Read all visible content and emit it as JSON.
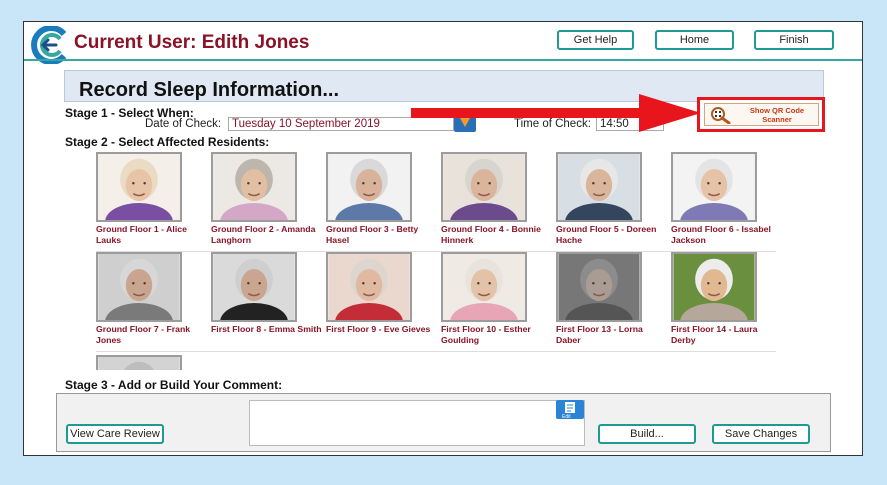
{
  "header": {
    "title": "Current User: Edith Jones",
    "buttons": {
      "help": "Get Help",
      "home": "Home",
      "finish": "Finish"
    }
  },
  "section": {
    "title": "Record Sleep Information..."
  },
  "stage1": {
    "label": "Stage 1 - Select When:",
    "date_label": "Date of Check:",
    "date_value": "Tuesday 10 September 2019",
    "time_label": "Time of Check:",
    "time_value": "14:50",
    "qr_button": "Show QR Code Scanner"
  },
  "stage2": {
    "label": "Stage 2 - Select Affected Residents:",
    "residents": [
      {
        "name": "Ground Floor 1 - Alice Lauks",
        "shirt": "#7a4fa3",
        "hair": "#e9dcc2",
        "skin": "#e8c3a5",
        "bg": "#f4efe9"
      },
      {
        "name": "Ground Floor 2 - Amanda Langhorn",
        "shirt": "#d4a7c7",
        "hair": "#bcb6ad",
        "skin": "#e2bfa2",
        "bg": "#ece9e4"
      },
      {
        "name": "Ground Floor 3 - Betty Hasel",
        "shirt": "#5d79a8",
        "hair": "#d9d9d9",
        "skin": "#d8b29a",
        "bg": "#f2f2f2"
      },
      {
        "name": "Ground Floor 4 - Bonnie Hinnerk",
        "shirt": "#6b4b8b",
        "hair": "#d8d4cf",
        "skin": "#dab49b",
        "bg": "#e9e2da"
      },
      {
        "name": "Ground Floor 5 - Doreen Hache",
        "shirt": "#34465e",
        "hair": "#e7e7e7",
        "skin": "#d9b59b",
        "bg": "#d7dfe5"
      },
      {
        "name": "Ground Floor 6 - Issabel Jackson",
        "shirt": "#7f79b6",
        "hair": "#e4e4e4",
        "skin": "#e6c2a7",
        "bg": "#f3f3f3"
      },
      {
        "name": "Ground Floor 7 - Frank Jones",
        "shirt": "#7a7a7a",
        "hair": "#d7d7d7",
        "skin": "#c9a48f",
        "bg": "#cfcfcf"
      },
      {
        "name": "First Floor 8 - Emma Smith",
        "shirt": "#222222",
        "hair": "#cfcfcf",
        "skin": "#caa58f",
        "bg": "#dadada"
      },
      {
        "name": "First Floor 9 - Eve Gieves",
        "shirt": "#c42d37",
        "hair": "#dcd6cf",
        "skin": "#e0b9a0",
        "bg": "#ead8cf"
      },
      {
        "name": "First Floor 10 - Esther Goulding",
        "shirt": "#e8a5b6",
        "hair": "#e8e4dd",
        "skin": "#e3c2a8",
        "bg": "#efeae4"
      },
      {
        "name": "First Floor 13 - Lorna Daber",
        "shirt": "#555555",
        "hair": "#8c8c8c",
        "skin": "#a99c92",
        "bg": "#777777"
      },
      {
        "name": "First Floor 14 - Laura Derby",
        "shirt": "#b6a79b",
        "hair": "#ececec",
        "skin": "#e1b990",
        "bg": "#6a8f3e"
      },
      {
        "name": "",
        "shirt": "#8a8a8a",
        "hair": "#bdbdbd",
        "skin": "#c9a48f",
        "bg": "#d3d3d3"
      }
    ]
  },
  "stage3": {
    "label": "Stage 3 - Add or Build Your Comment:",
    "view_care_review": "View Care Review",
    "edit_icon_label": "Edit",
    "build": "Build...",
    "save": "Save Changes"
  },
  "colors": {
    "accent": "#1e9a95",
    "title": "#8a1327",
    "highlight": "#e8151c"
  }
}
